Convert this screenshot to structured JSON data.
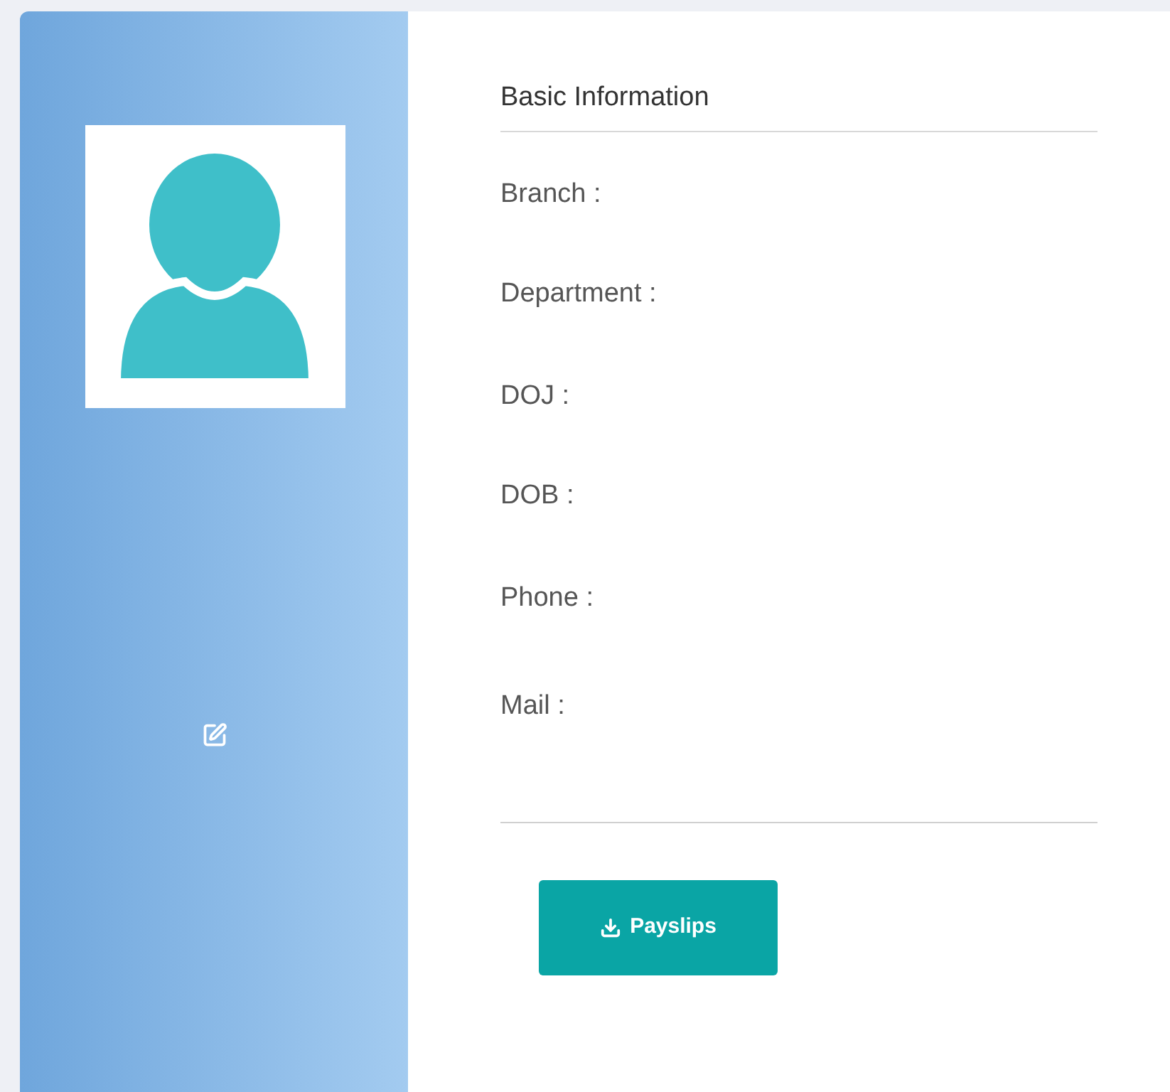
{
  "basic_information": {
    "title": "Basic Information",
    "fields": [
      {
        "label": "Branch :"
      },
      {
        "label": "Department :"
      },
      {
        "label": "DOJ :"
      },
      {
        "label": "DOB :"
      },
      {
        "label": "Phone :"
      },
      {
        "label": "Mail :"
      }
    ]
  },
  "actions": [
    {
      "label": "Payslips",
      "kind": "download"
    }
  ]
}
